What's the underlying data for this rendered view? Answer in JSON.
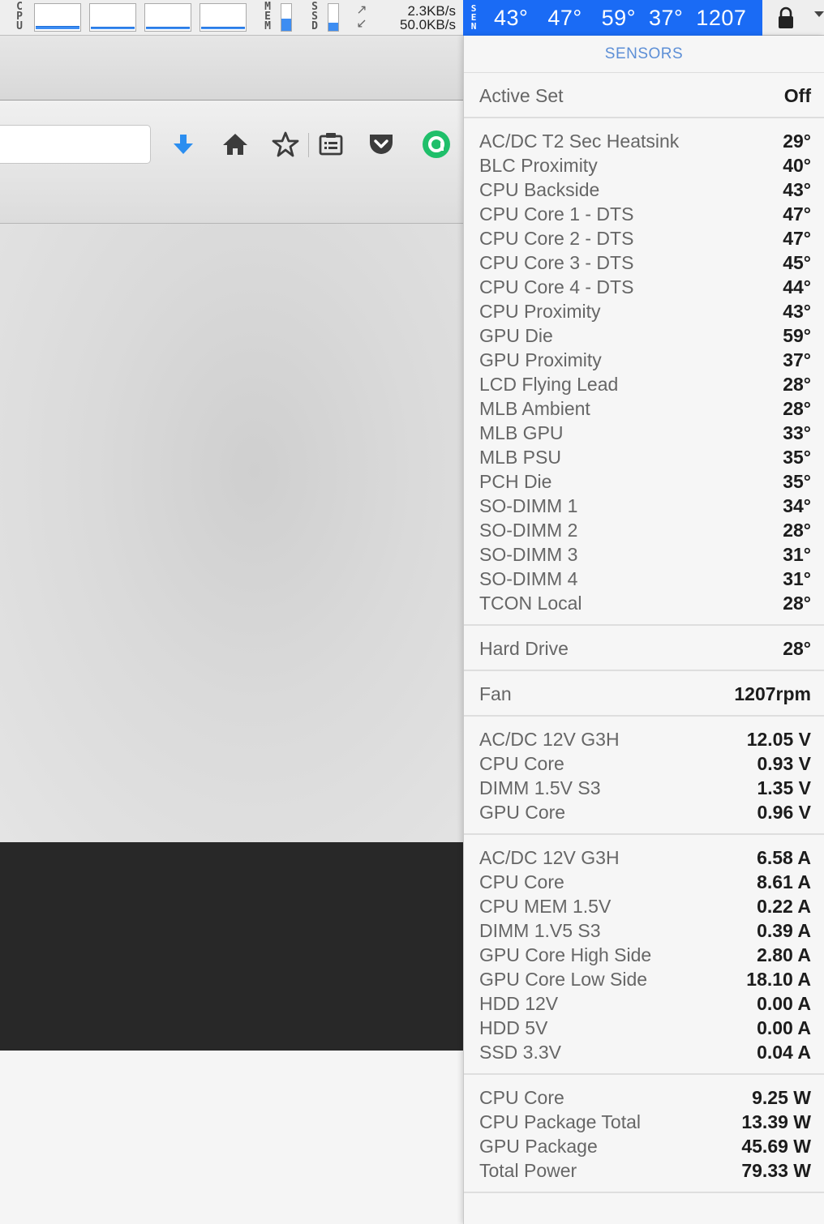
{
  "menubar": {
    "cpu_label": "CPU",
    "mem_label": "MEM",
    "ssd_label": "SSD",
    "mem_level": 0.45,
    "ssd_level": 0.3,
    "net": {
      "up": "2.3KB/s",
      "down": "50.0KB/s"
    },
    "sensors_icon_label": "SEN",
    "temps_readout": "43°   47°   59°  37°  1207",
    "accent_color": "#1a6bf5"
  },
  "browser": {
    "toolbar_icons": [
      "download-arrow-icon",
      "home-icon",
      "star-icon",
      "reading-list-icon",
      "pocket-icon",
      "green-extension-icon"
    ]
  },
  "sensors": {
    "title": "SENSORS",
    "active_set": {
      "label": "Active Set",
      "value": "Off"
    },
    "temperatures": [
      {
        "label": "AC/DC T2 Sec Heatsink",
        "value": "29°"
      },
      {
        "label": "BLC Proximity",
        "value": "40°"
      },
      {
        "label": "CPU Backside",
        "value": "43°"
      },
      {
        "label": "CPU Core 1 - DTS",
        "value": "47°"
      },
      {
        "label": "CPU Core 2 - DTS",
        "value": "47°"
      },
      {
        "label": "CPU Core 3 - DTS",
        "value": "45°"
      },
      {
        "label": "CPU Core 4 - DTS",
        "value": "44°"
      },
      {
        "label": "CPU Proximity",
        "value": "43°"
      },
      {
        "label": "GPU Die",
        "value": "59°"
      },
      {
        "label": "GPU Proximity",
        "value": "37°"
      },
      {
        "label": "LCD Flying Lead",
        "value": "28°"
      },
      {
        "label": "MLB Ambient",
        "value": "28°"
      },
      {
        "label": "MLB GPU",
        "value": "33°"
      },
      {
        "label": "MLB PSU",
        "value": "35°"
      },
      {
        "label": "PCH Die",
        "value": "35°"
      },
      {
        "label": "SO-DIMM 1",
        "value": "34°"
      },
      {
        "label": "SO-DIMM 2",
        "value": "28°"
      },
      {
        "label": "SO-DIMM 3",
        "value": "31°"
      },
      {
        "label": "SO-DIMM 4",
        "value": "31°"
      },
      {
        "label": "TCON Local",
        "value": "28°"
      }
    ],
    "hard_drive": {
      "label": "Hard Drive",
      "value": "28°"
    },
    "fan": {
      "label": "Fan",
      "value": "1207rpm"
    },
    "voltages": [
      {
        "label": "AC/DC 12V G3H",
        "value": "12.05 V"
      },
      {
        "label": "CPU Core",
        "value": "0.93 V"
      },
      {
        "label": "DIMM 1.5V S3",
        "value": "1.35 V"
      },
      {
        "label": "GPU Core",
        "value": "0.96 V"
      }
    ],
    "currents": [
      {
        "label": "AC/DC 12V G3H",
        "value": "6.58 A"
      },
      {
        "label": "CPU Core",
        "value": "8.61 A"
      },
      {
        "label": "CPU MEM 1.5V",
        "value": "0.22 A"
      },
      {
        "label": "DIMM 1.V5 S3",
        "value": "0.39 A"
      },
      {
        "label": "GPU Core High Side",
        "value": "2.80 A"
      },
      {
        "label": "GPU Core Low Side",
        "value": "18.10 A"
      },
      {
        "label": "HDD 12V",
        "value": "0.00 A"
      },
      {
        "label": "HDD 5V",
        "value": "0.00 A"
      },
      {
        "label": "SSD 3.3V",
        "value": "0.04 A"
      }
    ],
    "power": [
      {
        "label": "CPU Core",
        "value": "9.25 W"
      },
      {
        "label": "CPU Package Total",
        "value": "13.39 W"
      },
      {
        "label": "GPU Package",
        "value": "45.69 W"
      },
      {
        "label": "Total Power",
        "value": "79.33 W"
      }
    ]
  }
}
